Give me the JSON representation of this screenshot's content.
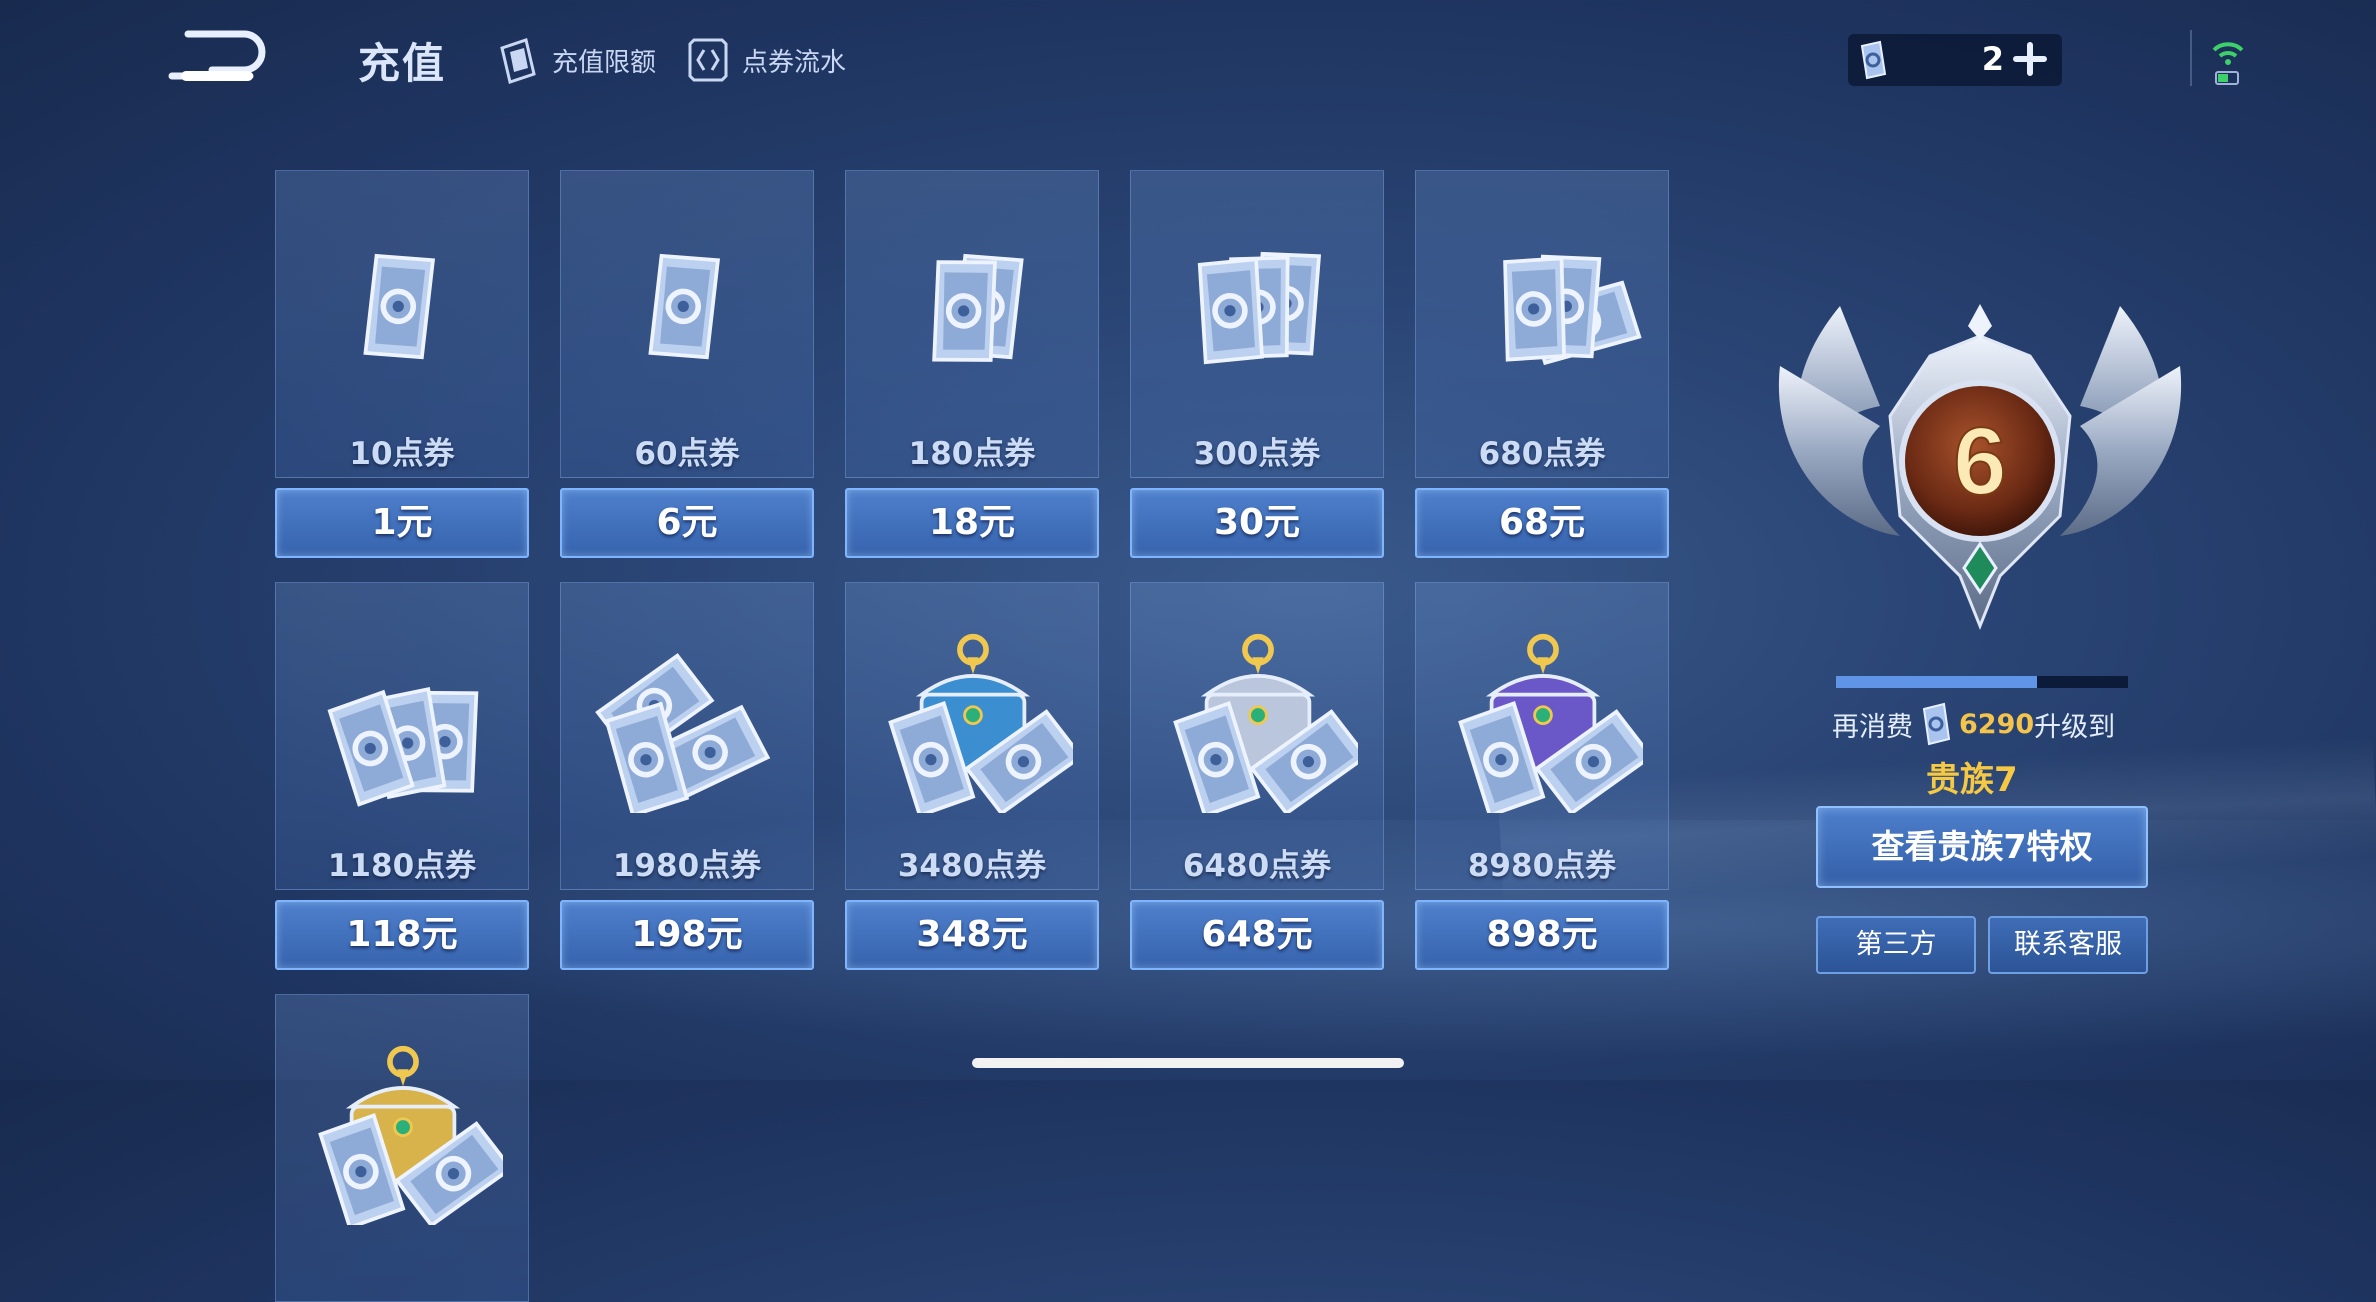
{
  "header": {
    "title": "充值",
    "links": [
      {
        "label": "充值限额",
        "icon": "card-icon"
      },
      {
        "label": "点券流水",
        "icon": "ledger-icon"
      }
    ],
    "balance": "2"
  },
  "packages": [
    {
      "amount": "10点券",
      "price": "1元",
      "art": "single-card"
    },
    {
      "amount": "60点券",
      "price": "6元",
      "art": "single-card"
    },
    {
      "amount": "180点券",
      "price": "18元",
      "art": "two-cards"
    },
    {
      "amount": "300点券",
      "price": "30元",
      "art": "three-cards"
    },
    {
      "amount": "680点券",
      "price": "68元",
      "art": "card-stack"
    },
    {
      "amount": "1180点券",
      "price": "118元",
      "art": "card-pile"
    },
    {
      "amount": "1980点券",
      "price": "198元",
      "art": "card-heap"
    },
    {
      "amount": "3480点券",
      "price": "348元",
      "art": "blue-chest"
    },
    {
      "amount": "6480点券",
      "price": "648元",
      "art": "silver-chest"
    },
    {
      "amount": "8980点券",
      "price": "898元",
      "art": "purple-chest"
    },
    {
      "amount": "",
      "price": "",
      "art": "gold-chest"
    }
  ],
  "noble": {
    "current_level": "6",
    "progress": 0.69,
    "upgrade_prefix": "再消费",
    "upgrade_amount": "6290",
    "upgrade_suffix": "升级到",
    "next_level": "贵族7",
    "view_button": "查看贵族7特权",
    "third_party_button": "第三方",
    "support_button": "联系客服"
  },
  "colors": {
    "accent": "#5f94e6",
    "gold": "#f5c44a",
    "button": "#3e6db7"
  }
}
